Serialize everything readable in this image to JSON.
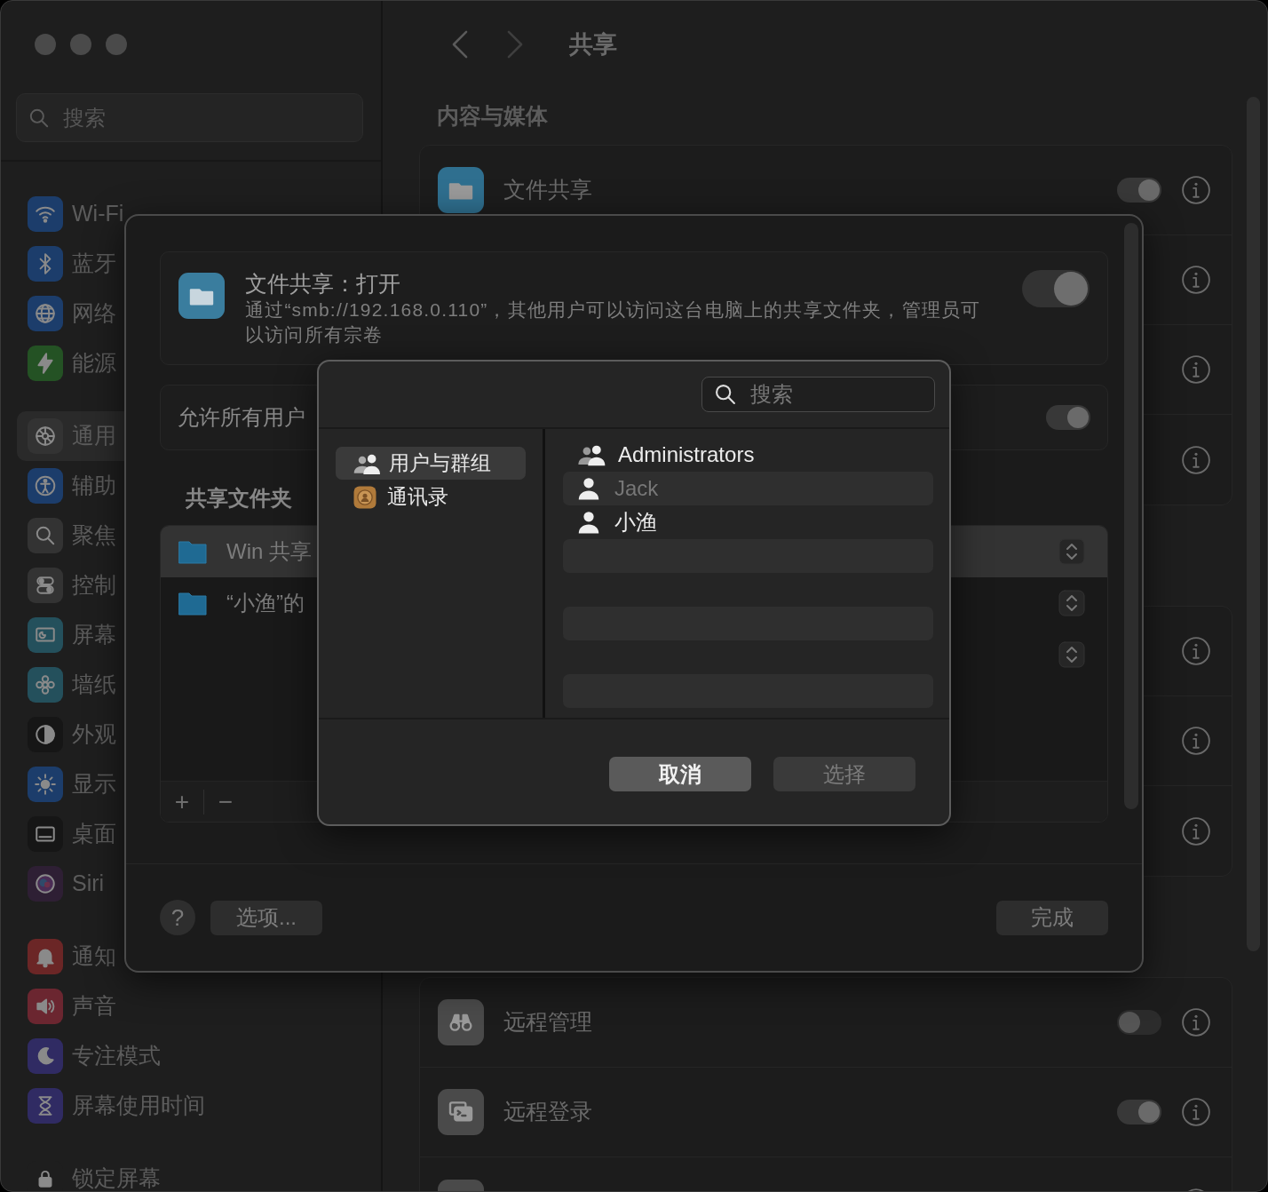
{
  "sidebar": {
    "search": {
      "placeholder": "搜索"
    },
    "groups": [
      {
        "items": [
          {
            "label": "Wi-Fi",
            "color": "#1c3d6b",
            "selected": false
          },
          {
            "label": "蓝牙",
            "color": "#1c3d6b",
            "selected": false
          },
          {
            "label": "网络",
            "color": "#1c3d6b",
            "selected": false
          },
          {
            "label": "能源",
            "color": "#245224",
            "selected": false
          }
        ]
      },
      {
        "items": [
          {
            "label": "通用",
            "color": "#333333",
            "selected": true
          },
          {
            "label": "辅助",
            "color": "#1c3d6b",
            "selected": false
          },
          {
            "label": "聚焦",
            "color": "#333333",
            "selected": false
          },
          {
            "label": "控制",
            "color": "#333333",
            "selected": false
          },
          {
            "label": "屏幕",
            "color": "#24505c",
            "selected": false
          },
          {
            "label": "墙纸",
            "color": "#24505c",
            "selected": false
          },
          {
            "label": "外观",
            "color": "#161616",
            "selected": false
          },
          {
            "label": "显示",
            "color": "#1c3d6b",
            "selected": false
          },
          {
            "label": "桌面",
            "color": "#161616",
            "selected": false
          },
          {
            "label": "Siri",
            "color": "#2e1f34",
            "selected": false
          }
        ]
      },
      {
        "items": [
          {
            "label": "通知",
            "color": "#6b2626",
            "selected": false
          },
          {
            "label": "声音",
            "color": "#6b2630",
            "selected": false
          },
          {
            "label": "专注模式",
            "color": "#302b63",
            "selected": false
          },
          {
            "label": "屏幕使用时间",
            "color": "#302b63",
            "selected": false
          }
        ]
      },
      {
        "items": [
          {
            "label": "锁定屏幕",
            "color": "#1e1e1e",
            "selected": false
          }
        ]
      }
    ]
  },
  "toolbar": {
    "title": "共享"
  },
  "main": {
    "section": "内容与媒体",
    "cards": [
      {
        "rows": [
          {
            "kind": "service",
            "label": "文件共享",
            "on": true
          },
          {
            "kind": "covered"
          },
          {
            "kind": "covered"
          },
          {
            "kind": "covered"
          }
        ]
      },
      {
        "rows": [
          {
            "kind": "covered"
          },
          {
            "kind": "covered"
          },
          {
            "kind": "covered"
          }
        ]
      },
      {
        "rows": [
          {
            "kind": "service",
            "label": "远程管理",
            "on": false
          },
          {
            "kind": "service",
            "label": "远程登录",
            "on": true
          },
          {
            "kind": "covered"
          }
        ]
      }
    ]
  },
  "sheet": {
    "title": "文件共享：打开",
    "description": "通过“smb://192.168.0.110”，其他用户可以访问这台电脑上的共享文件夹，管理员可以访问所有宗卷",
    "on": true,
    "allow_row": {
      "label": "允许所有用户",
      "on": true
    },
    "folders_heading": "共享文件夹",
    "folders": [
      {
        "name": "Win 共享",
        "selected": true
      },
      {
        "name": "“小渔”的",
        "selected": false
      }
    ],
    "add_button": "+",
    "remove_button": "−",
    "help_button": "?",
    "options_button": "选项...",
    "done_button": "完成"
  },
  "dialog": {
    "search": {
      "placeholder": "搜索"
    },
    "sources": [
      {
        "label": "用户与群组",
        "selected": true
      },
      {
        "label": "通讯录",
        "selected": false
      }
    ],
    "users": [
      {
        "label": "Administrators",
        "kind": "group",
        "disabled": false
      },
      {
        "label": "Jack",
        "kind": "user",
        "disabled": true
      },
      {
        "label": "小渔",
        "kind": "user",
        "disabled": false
      }
    ],
    "buttons": [
      {
        "label": "取消",
        "default": true,
        "disabled": false
      },
      {
        "label": "选择",
        "default": false,
        "disabled": true
      }
    ]
  }
}
